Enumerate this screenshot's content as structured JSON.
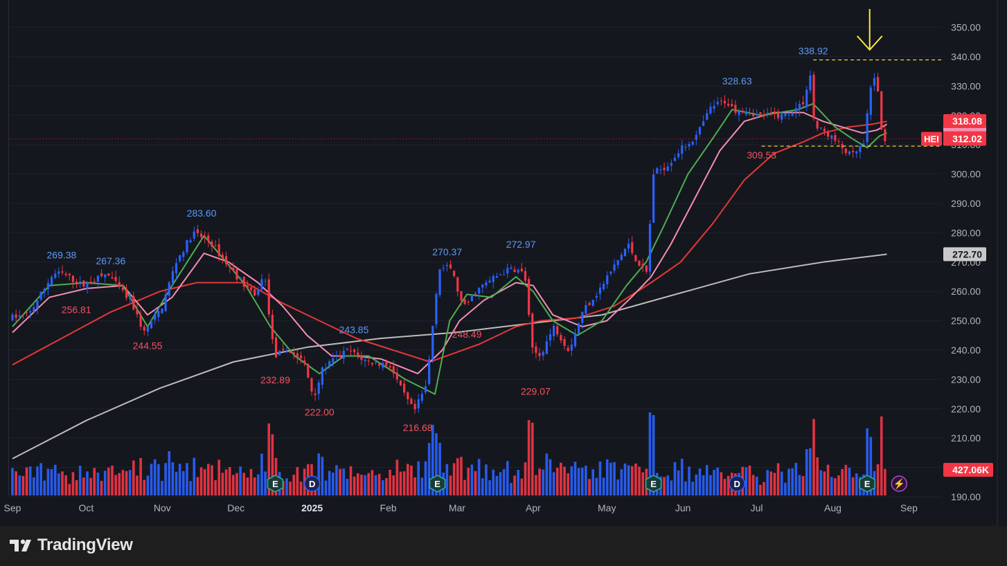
{
  "branding": {
    "name": "TradingView"
  },
  "colors": {
    "background": "#15171f",
    "up": "#2962ff",
    "down": "#f23645",
    "ma_fast": "#4caf50",
    "ma_mid": "#f48fb1",
    "ma_50": "#e53935",
    "ma_200": "#bdbdbd",
    "annotation_high": "#5b9cf6",
    "annotation_low": "#f7525f",
    "arrow": "#ffeb3b"
  },
  "chart_data": {
    "type": "candlestick",
    "symbol": "HEI",
    "y_axis": {
      "ticks": [
        "350.00",
        "340.00",
        "330.00",
        "320.00",
        "310.00",
        "300.00",
        "290.00",
        "280.00",
        "270.00",
        "260.00",
        "250.00",
        "240.00",
        "230.00",
        "220.00",
        "210.00",
        "200.00",
        "190.00"
      ],
      "range": [
        187,
        353
      ]
    },
    "x_axis": {
      "ticks": [
        "Sep",
        "Oct",
        "Nov",
        "Dec",
        "2025",
        "Feb",
        "Mar",
        "Apr",
        "May",
        "Jun",
        "Jul",
        "Aug",
        "Sep"
      ],
      "tick_days": [
        0,
        30,
        61,
        91,
        122,
        153,
        181,
        212,
        242,
        273,
        303,
        334,
        365
      ],
      "range_days": [
        0,
        366
      ]
    },
    "price_labels": {
      "last_close": "312.02",
      "prev_close": "318.08",
      "ma200": "272.70",
      "volume": "427.06K",
      "ma_hidden_1": "314.5",
      "ma_hidden_2": "316.0"
    },
    "dashed_levels": [
      338.92,
      309.53
    ],
    "annotations": [
      {
        "text": "269.38",
        "day": 20,
        "value": 269.38,
        "type": "high"
      },
      {
        "text": "267.36",
        "day": 40,
        "value": 267.36,
        "type": "high"
      },
      {
        "text": "256.81",
        "day": 26,
        "value": 256.81,
        "type": "low"
      },
      {
        "text": "244.55",
        "day": 55,
        "value": 244.55,
        "type": "low"
      },
      {
        "text": "283.60",
        "day": 77,
        "value": 283.6,
        "type": "high"
      },
      {
        "text": "232.89",
        "day": 107,
        "value": 232.89,
        "type": "low"
      },
      {
        "text": "222.00",
        "day": 125,
        "value": 222.0,
        "type": "low"
      },
      {
        "text": "243.85",
        "day": 139,
        "value": 243.85,
        "type": "high"
      },
      {
        "text": "216.68",
        "day": 165,
        "value": 216.68,
        "type": "low"
      },
      {
        "text": "270.37",
        "day": 177,
        "value": 270.37,
        "type": "high"
      },
      {
        "text": "248.49",
        "day": 185,
        "value": 248.49,
        "type": "low"
      },
      {
        "text": "272.97",
        "day": 207,
        "value": 272.97,
        "type": "high"
      },
      {
        "text": "229.07",
        "day": 213,
        "value": 229.07,
        "type": "low"
      },
      {
        "text": "328.63",
        "day": 295,
        "value": 328.63,
        "type": "high"
      },
      {
        "text": "309.53",
        "day": 305,
        "value": 309.53,
        "type": "low"
      },
      {
        "text": "338.92",
        "day": 326,
        "value": 338.92,
        "type": "high"
      }
    ],
    "event_markers": [
      {
        "letter": "E",
        "day": 107
      },
      {
        "letter": "D",
        "day": 122
      },
      {
        "letter": "E",
        "day": 173
      },
      {
        "letter": "E",
        "day": 261
      },
      {
        "letter": "D",
        "day": 295
      },
      {
        "letter": "E",
        "day": 348
      }
    ],
    "anchors": [
      [
        0,
        251
      ],
      [
        8,
        252
      ],
      [
        18,
        266
      ],
      [
        22,
        266
      ],
      [
        30,
        262
      ],
      [
        40,
        266
      ],
      [
        50,
        256
      ],
      [
        55,
        246
      ],
      [
        62,
        254
      ],
      [
        68,
        270
      ],
      [
        75,
        280
      ],
      [
        82,
        277
      ],
      [
        90,
        268
      ],
      [
        96,
        262
      ],
      [
        100,
        258
      ],
      [
        104,
        266
      ],
      [
        108,
        238
      ],
      [
        114,
        240
      ],
      [
        120,
        236
      ],
      [
        124,
        224
      ],
      [
        128,
        234
      ],
      [
        138,
        240
      ],
      [
        146,
        236
      ],
      [
        155,
        235
      ],
      [
        160,
        226
      ],
      [
        165,
        219
      ],
      [
        170,
        228
      ],
      [
        175,
        268
      ],
      [
        180,
        268
      ],
      [
        185,
        254
      ],
      [
        190,
        260
      ],
      [
        198,
        265
      ],
      [
        205,
        268
      ],
      [
        210,
        266
      ],
      [
        213,
        240
      ],
      [
        216,
        238
      ],
      [
        222,
        248
      ],
      [
        225,
        244
      ],
      [
        228,
        240
      ],
      [
        234,
        254
      ],
      [
        240,
        260
      ],
      [
        246,
        268
      ],
      [
        252,
        276
      ],
      [
        256,
        270
      ],
      [
        260,
        266
      ],
      [
        262,
        300
      ],
      [
        268,
        303
      ],
      [
        273,
        308
      ],
      [
        280,
        313
      ],
      [
        286,
        323
      ],
      [
        292,
        325
      ],
      [
        295,
        322
      ],
      [
        300,
        322
      ],
      [
        305,
        320
      ],
      [
        310,
        320
      ],
      [
        315,
        320
      ],
      [
        320,
        322
      ],
      [
        324,
        325
      ],
      [
        326,
        336
      ],
      [
        328,
        316
      ],
      [
        333,
        314
      ],
      [
        338,
        310
      ],
      [
        343,
        306
      ],
      [
        348,
        310
      ],
      [
        351,
        330
      ],
      [
        353,
        335
      ],
      [
        355,
        316
      ],
      [
        356,
        312
      ]
    ],
    "ma_fast": [
      [
        0,
        248
      ],
      [
        15,
        262
      ],
      [
        30,
        263
      ],
      [
        45,
        262
      ],
      [
        55,
        248
      ],
      [
        65,
        262
      ],
      [
        78,
        279
      ],
      [
        85,
        272
      ],
      [
        95,
        262
      ],
      [
        105,
        248
      ],
      [
        115,
        238
      ],
      [
        125,
        232
      ],
      [
        135,
        238
      ],
      [
        145,
        238
      ],
      [
        160,
        230
      ],
      [
        172,
        225
      ],
      [
        178,
        250
      ],
      [
        185,
        259
      ],
      [
        195,
        258
      ],
      [
        205,
        265
      ],
      [
        212,
        260
      ],
      [
        220,
        250
      ],
      [
        230,
        245
      ],
      [
        240,
        250
      ],
      [
        250,
        262
      ],
      [
        258,
        270
      ],
      [
        265,
        282
      ],
      [
        275,
        300
      ],
      [
        285,
        312
      ],
      [
        293,
        322
      ],
      [
        305,
        320
      ],
      [
        320,
        322
      ],
      [
        326,
        324
      ],
      [
        335,
        316
      ],
      [
        342,
        312
      ],
      [
        348,
        309
      ],
      [
        353,
        313
      ],
      [
        356,
        314
      ]
    ],
    "ma_mid": [
      [
        0,
        246
      ],
      [
        15,
        258
      ],
      [
        30,
        261
      ],
      [
        45,
        262
      ],
      [
        55,
        252
      ],
      [
        65,
        258
      ],
      [
        78,
        273
      ],
      [
        88,
        270
      ],
      [
        100,
        263
      ],
      [
        110,
        255
      ],
      [
        120,
        245
      ],
      [
        130,
        238
      ],
      [
        140,
        238
      ],
      [
        150,
        237
      ],
      [
        165,
        232
      ],
      [
        175,
        240
      ],
      [
        182,
        250
      ],
      [
        192,
        257
      ],
      [
        205,
        263
      ],
      [
        212,
        262
      ],
      [
        220,
        252
      ],
      [
        232,
        248
      ],
      [
        242,
        250
      ],
      [
        252,
        258
      ],
      [
        260,
        265
      ],
      [
        268,
        276
      ],
      [
        278,
        292
      ],
      [
        288,
        308
      ],
      [
        298,
        318
      ],
      [
        310,
        321
      ],
      [
        322,
        321
      ],
      [
        330,
        318
      ],
      [
        338,
        316
      ],
      [
        346,
        314
      ],
      [
        352,
        315
      ],
      [
        356,
        317
      ]
    ],
    "ma50": [
      [
        0,
        235
      ],
      [
        20,
        244
      ],
      [
        40,
        253
      ],
      [
        60,
        260
      ],
      [
        75,
        263
      ],
      [
        95,
        263
      ],
      [
        110,
        256
      ],
      [
        125,
        250
      ],
      [
        140,
        244
      ],
      [
        155,
        240
      ],
      [
        170,
        236
      ],
      [
        180,
        239
      ],
      [
        190,
        242
      ],
      [
        205,
        248
      ],
      [
        215,
        250
      ],
      [
        230,
        251
      ],
      [
        245,
        255
      ],
      [
        260,
        263
      ],
      [
        272,
        270
      ],
      [
        285,
        283
      ],
      [
        298,
        298
      ],
      [
        310,
        307
      ],
      [
        322,
        311
      ],
      [
        330,
        314
      ],
      [
        340,
        316
      ],
      [
        350,
        317
      ],
      [
        356,
        318
      ]
    ],
    "ma200": [
      [
        0,
        203
      ],
      [
        30,
        216
      ],
      [
        60,
        227
      ],
      [
        90,
        236
      ],
      [
        120,
        241
      ],
      [
        150,
        244
      ],
      [
        180,
        246
      ],
      [
        210,
        249
      ],
      [
        240,
        252
      ],
      [
        270,
        259
      ],
      [
        300,
        266
      ],
      [
        330,
        270
      ],
      [
        356,
        272.7
      ]
    ]
  }
}
